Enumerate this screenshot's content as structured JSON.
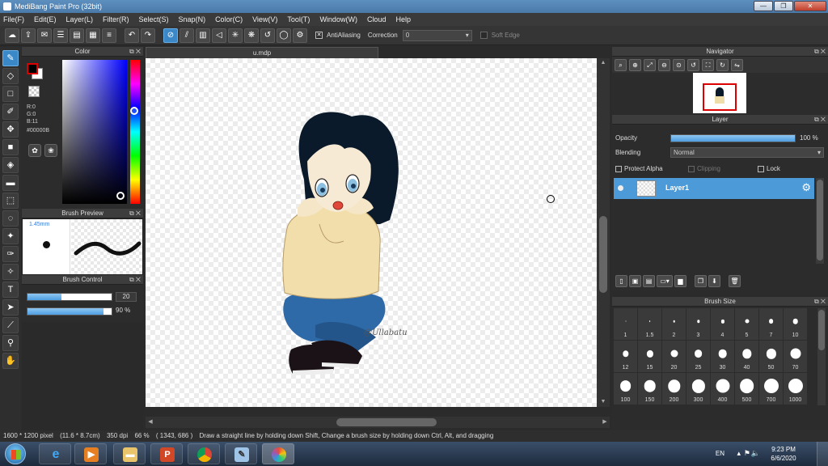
{
  "window": {
    "title": "MediBang Paint Pro (32bit)",
    "minimize": "—",
    "maximize": "❐",
    "close": "✕"
  },
  "menu": [
    "File(F)",
    "Edit(E)",
    "Layer(L)",
    "Filter(R)",
    "Select(S)",
    "Snap(N)",
    "Color(C)",
    "View(V)",
    "Tool(T)",
    "Window(W)",
    "Cloud",
    "Help"
  ],
  "toolbar": {
    "antialiasing_label": "AntiAliasing",
    "antialiasing_checked": "✕",
    "correction_label": "Correction",
    "correction_value": "0",
    "soft_edge_label": "Soft Edge"
  },
  "color_panel": {
    "title": "Color",
    "r": "R:0",
    "g": "G:0",
    "b": "B:11",
    "hex": "#00000B",
    "foreground": "#00000B"
  },
  "brush_preview": {
    "title": "Brush Preview",
    "size": "1.45mm"
  },
  "brush_control": {
    "title": "Brush Control",
    "size_value": "20",
    "size_fraction": 0.4,
    "opacity_value": "90 %",
    "opacity_fraction": 0.9
  },
  "document": {
    "tab_name": "u.mdp",
    "signature": "@Ullabatu"
  },
  "navigator": {
    "title": "Navigator"
  },
  "layer_panel": {
    "title": "Layer",
    "opacity_label": "Opacity",
    "opacity_value": "100 %",
    "blending_label": "Blending",
    "blending_value": "Normal",
    "protect_alpha": "Protect Alpha",
    "clipping": "Clipping",
    "lock": "Lock",
    "layers": [
      {
        "name": "Layer1"
      }
    ]
  },
  "brush_size": {
    "title": "Brush Size",
    "sizes": [
      "1",
      "1.5",
      "2",
      "3",
      "4",
      "5",
      "7",
      "10",
      "12",
      "15",
      "20",
      "25",
      "30",
      "40",
      "50",
      "70",
      "100",
      "150",
      "200",
      "300",
      "400",
      "500",
      "700",
      "1000"
    ]
  },
  "status": {
    "dimensions": "1600 * 1200 pixel",
    "physical": "(11.6 * 8.7cm)",
    "dpi": "350 dpi",
    "zoom": "66 %",
    "cursor": "( 1343, 686 )",
    "hint": "Draw a straight line by holding down Shift, Change a brush size by holding down Ctrl, Alt, and dragging"
  },
  "taskbar": {
    "lang": "EN",
    "time": "9:23 PM",
    "date": "6/6/2020"
  }
}
